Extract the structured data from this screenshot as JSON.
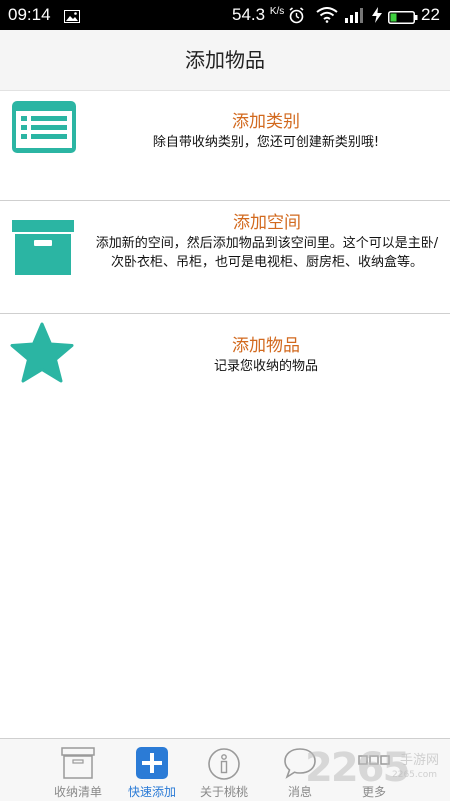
{
  "status_bar": {
    "time": "09:14",
    "net_speed": "54.3",
    "net_speed_unit": "K/s",
    "battery_level": "22"
  },
  "header": {
    "title": "添加物品"
  },
  "options": [
    {
      "title": "添加类别",
      "description": "除自带收纳类别，您还可创建新类别哦!",
      "icon": "list-icon"
    },
    {
      "title": "添加空间",
      "description": "添加新的空间，然后添加物品到该空间里。这个可以是主卧/次卧衣柜、吊柜，也可是电视柜、厨房柜、收纳盒等。",
      "icon": "box-icon"
    },
    {
      "title": "添加物品",
      "description": "记录您收纳的物品",
      "icon": "star-icon"
    }
  ],
  "tabs": [
    {
      "label": "收纳清单",
      "icon": "storage-box-icon"
    },
    {
      "label": "快速添加",
      "icon": "plus-icon",
      "active": true
    },
    {
      "label": "关于桃桃",
      "icon": "info-icon"
    },
    {
      "label": "消息",
      "icon": "chat-bubble-icon"
    },
    {
      "label": "更多",
      "icon": "more-icon"
    }
  ],
  "watermark": {
    "number": "2265",
    "site": "手游网",
    "domain": "2265.com"
  },
  "colors": {
    "accent_teal": "#2bb5a3",
    "title_orange": "#d2691e",
    "tab_active_blue": "#2b7bd6",
    "tab_inactive_gray": "#8a8a8a"
  }
}
